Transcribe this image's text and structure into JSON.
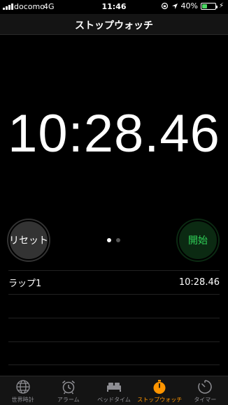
{
  "status_bar": {
    "carrier": "docomo",
    "network": "4G",
    "time": "11:46",
    "battery_percent": "40%",
    "battery_level": 0.4
  },
  "header": {
    "title": "ストップウォッチ"
  },
  "stopwatch": {
    "time": "10:28.46",
    "reset_label": "リセット",
    "start_label": "開始",
    "page_count": 2,
    "active_page": 1
  },
  "laps": [
    {
      "label": "ラップ1",
      "time": "10:28.46"
    }
  ],
  "tabs": [
    {
      "label": "世界時計",
      "icon": "globe-icon",
      "active": false
    },
    {
      "label": "アラーム",
      "icon": "alarm-clock-icon",
      "active": false
    },
    {
      "label": "ベッドタイム",
      "icon": "bed-icon",
      "active": false
    },
    {
      "label": "ストップウォッチ",
      "icon": "stopwatch-icon",
      "active": true
    },
    {
      "label": "タイマー",
      "icon": "timer-icon",
      "active": false
    }
  ],
  "colors": {
    "accent": "#ff9500",
    "start_green": "#30d158",
    "battery_green": "#4cd964"
  }
}
